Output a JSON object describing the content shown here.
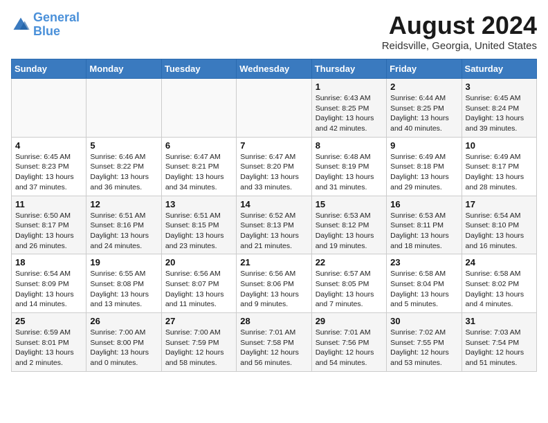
{
  "header": {
    "logo_line1": "General",
    "logo_line2": "Blue",
    "title": "August 2024",
    "subtitle": "Reidsville, Georgia, United States"
  },
  "weekdays": [
    "Sunday",
    "Monday",
    "Tuesday",
    "Wednesday",
    "Thursday",
    "Friday",
    "Saturday"
  ],
  "weeks": [
    [
      {
        "day": "",
        "info": ""
      },
      {
        "day": "",
        "info": ""
      },
      {
        "day": "",
        "info": ""
      },
      {
        "day": "",
        "info": ""
      },
      {
        "day": "1",
        "info": "Sunrise: 6:43 AM\nSunset: 8:25 PM\nDaylight: 13 hours and 42 minutes."
      },
      {
        "day": "2",
        "info": "Sunrise: 6:44 AM\nSunset: 8:25 PM\nDaylight: 13 hours and 40 minutes."
      },
      {
        "day": "3",
        "info": "Sunrise: 6:45 AM\nSunset: 8:24 PM\nDaylight: 13 hours and 39 minutes."
      }
    ],
    [
      {
        "day": "4",
        "info": "Sunrise: 6:45 AM\nSunset: 8:23 PM\nDaylight: 13 hours and 37 minutes."
      },
      {
        "day": "5",
        "info": "Sunrise: 6:46 AM\nSunset: 8:22 PM\nDaylight: 13 hours and 36 minutes."
      },
      {
        "day": "6",
        "info": "Sunrise: 6:47 AM\nSunset: 8:21 PM\nDaylight: 13 hours and 34 minutes."
      },
      {
        "day": "7",
        "info": "Sunrise: 6:47 AM\nSunset: 8:20 PM\nDaylight: 13 hours and 33 minutes."
      },
      {
        "day": "8",
        "info": "Sunrise: 6:48 AM\nSunset: 8:19 PM\nDaylight: 13 hours and 31 minutes."
      },
      {
        "day": "9",
        "info": "Sunrise: 6:49 AM\nSunset: 8:18 PM\nDaylight: 13 hours and 29 minutes."
      },
      {
        "day": "10",
        "info": "Sunrise: 6:49 AM\nSunset: 8:17 PM\nDaylight: 13 hours and 28 minutes."
      }
    ],
    [
      {
        "day": "11",
        "info": "Sunrise: 6:50 AM\nSunset: 8:17 PM\nDaylight: 13 hours and 26 minutes."
      },
      {
        "day": "12",
        "info": "Sunrise: 6:51 AM\nSunset: 8:16 PM\nDaylight: 13 hours and 24 minutes."
      },
      {
        "day": "13",
        "info": "Sunrise: 6:51 AM\nSunset: 8:15 PM\nDaylight: 13 hours and 23 minutes."
      },
      {
        "day": "14",
        "info": "Sunrise: 6:52 AM\nSunset: 8:13 PM\nDaylight: 13 hours and 21 minutes."
      },
      {
        "day": "15",
        "info": "Sunrise: 6:53 AM\nSunset: 8:12 PM\nDaylight: 13 hours and 19 minutes."
      },
      {
        "day": "16",
        "info": "Sunrise: 6:53 AM\nSunset: 8:11 PM\nDaylight: 13 hours and 18 minutes."
      },
      {
        "day": "17",
        "info": "Sunrise: 6:54 AM\nSunset: 8:10 PM\nDaylight: 13 hours and 16 minutes."
      }
    ],
    [
      {
        "day": "18",
        "info": "Sunrise: 6:54 AM\nSunset: 8:09 PM\nDaylight: 13 hours and 14 minutes."
      },
      {
        "day": "19",
        "info": "Sunrise: 6:55 AM\nSunset: 8:08 PM\nDaylight: 13 hours and 13 minutes."
      },
      {
        "day": "20",
        "info": "Sunrise: 6:56 AM\nSunset: 8:07 PM\nDaylight: 13 hours and 11 minutes."
      },
      {
        "day": "21",
        "info": "Sunrise: 6:56 AM\nSunset: 8:06 PM\nDaylight: 13 hours and 9 minutes."
      },
      {
        "day": "22",
        "info": "Sunrise: 6:57 AM\nSunset: 8:05 PM\nDaylight: 13 hours and 7 minutes."
      },
      {
        "day": "23",
        "info": "Sunrise: 6:58 AM\nSunset: 8:04 PM\nDaylight: 13 hours and 5 minutes."
      },
      {
        "day": "24",
        "info": "Sunrise: 6:58 AM\nSunset: 8:02 PM\nDaylight: 13 hours and 4 minutes."
      }
    ],
    [
      {
        "day": "25",
        "info": "Sunrise: 6:59 AM\nSunset: 8:01 PM\nDaylight: 13 hours and 2 minutes."
      },
      {
        "day": "26",
        "info": "Sunrise: 7:00 AM\nSunset: 8:00 PM\nDaylight: 13 hours and 0 minutes."
      },
      {
        "day": "27",
        "info": "Sunrise: 7:00 AM\nSunset: 7:59 PM\nDaylight: 12 hours and 58 minutes."
      },
      {
        "day": "28",
        "info": "Sunrise: 7:01 AM\nSunset: 7:58 PM\nDaylight: 12 hours and 56 minutes."
      },
      {
        "day": "29",
        "info": "Sunrise: 7:01 AM\nSunset: 7:56 PM\nDaylight: 12 hours and 54 minutes."
      },
      {
        "day": "30",
        "info": "Sunrise: 7:02 AM\nSunset: 7:55 PM\nDaylight: 12 hours and 53 minutes."
      },
      {
        "day": "31",
        "info": "Sunrise: 7:03 AM\nSunset: 7:54 PM\nDaylight: 12 hours and 51 minutes."
      }
    ]
  ]
}
